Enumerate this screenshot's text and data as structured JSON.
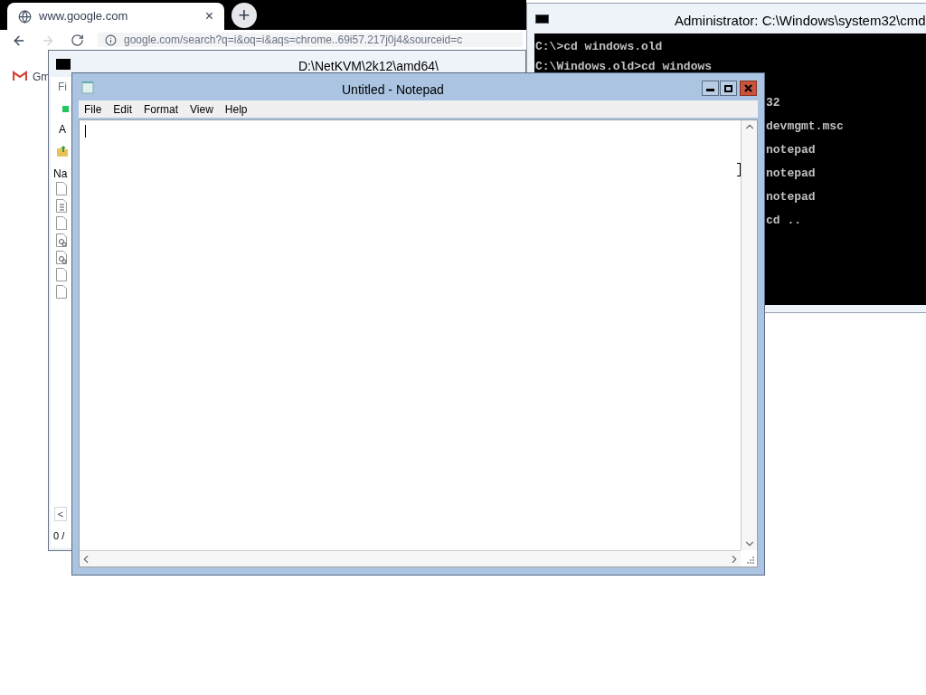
{
  "browser": {
    "tab": {
      "title": "www.google.com",
      "close": "×"
    },
    "new_tab": "+",
    "address": "google.com/search?q=i&oq=i&aqs=chrome..69i57.217j0j4&sourceid=c",
    "bookmark": "Gm"
  },
  "archive_window": {
    "title": "D:\\NetKVM\\2k12\\amd64\\",
    "menu": "Fi",
    "toolbar_label": "A",
    "column": "Na",
    "files": [
      {
        "kind": "document"
      },
      {
        "kind": "text"
      },
      {
        "kind": "document"
      },
      {
        "kind": "settings"
      },
      {
        "kind": "settings"
      },
      {
        "kind": "document"
      },
      {
        "kind": "document"
      }
    ],
    "scroll": "<",
    "status": "0 /"
  },
  "console_window": {
    "title": "Administrator: C:\\Windows\\system32\\cmd",
    "lines": [
      "C:\\>cd windows.old",
      "C:\\Windows.old>cd windows"
    ],
    "tails": [
      "32",
      "devmgmt.msc",
      "notepad",
      "notepad",
      "notepad",
      "cd .."
    ]
  },
  "notepad": {
    "title": "Untitled - Notepad",
    "menu": [
      "File",
      "Edit",
      "Format",
      "View",
      "Help"
    ]
  }
}
